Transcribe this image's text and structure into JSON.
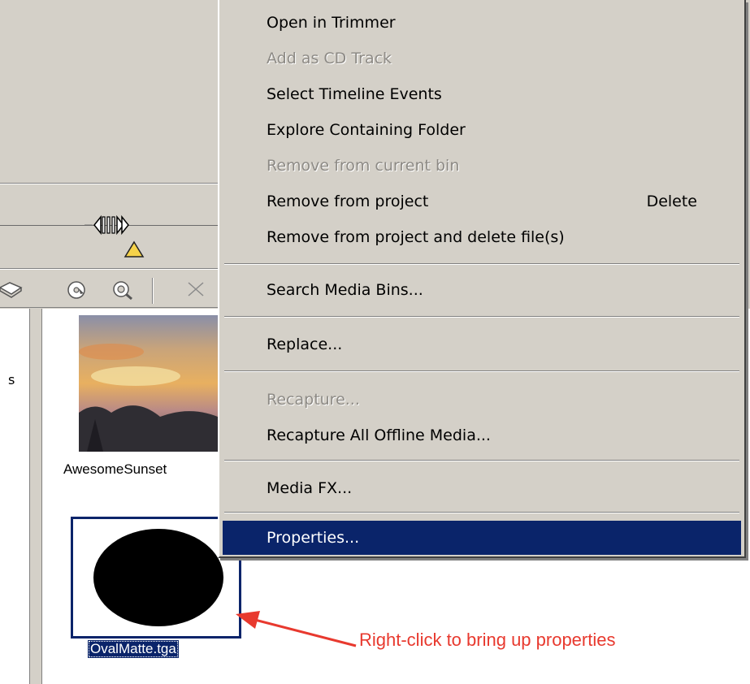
{
  "media": {
    "sunset_caption": "AwesomeSunset",
    "oval_caption": "OvalMatte.tga"
  },
  "tree": {
    "partial_label": "s"
  },
  "annotation": {
    "text": "Right-click to bring up properties",
    "color": "#e8392e"
  },
  "context_menu": {
    "items": [
      {
        "label": "Open in Trimmer",
        "enabled": true
      },
      {
        "label": "Add as CD Track",
        "enabled": false
      },
      {
        "label": "Select Timeline Events",
        "enabled": true
      },
      {
        "label": "Explore Containing Folder",
        "enabled": true
      },
      {
        "label": "Remove from current bin",
        "enabled": false
      },
      {
        "label": "Remove from project",
        "shortcut": "Delete",
        "enabled": true
      },
      {
        "label": "Remove from project and delete file(s)",
        "enabled": true
      },
      {
        "label": "Search Media Bins...",
        "enabled": true
      },
      {
        "label": "Replace...",
        "enabled": true
      },
      {
        "label": "Recapture...",
        "enabled": false
      },
      {
        "label": "Recapture All Offline Media...",
        "enabled": true
      },
      {
        "label": "Media FX...",
        "enabled": true
      },
      {
        "label": "Properties...",
        "enabled": true,
        "selected": true
      }
    ]
  },
  "colors": {
    "selection": "#0a246a",
    "face": "#d4d0c8",
    "disabled_text": "#8d8a85"
  },
  "icons": [
    "scrubber-icon",
    "warning-icon",
    "open-folder-icon",
    "import-cd-icon",
    "search-media-icon",
    "cut-icon"
  ]
}
